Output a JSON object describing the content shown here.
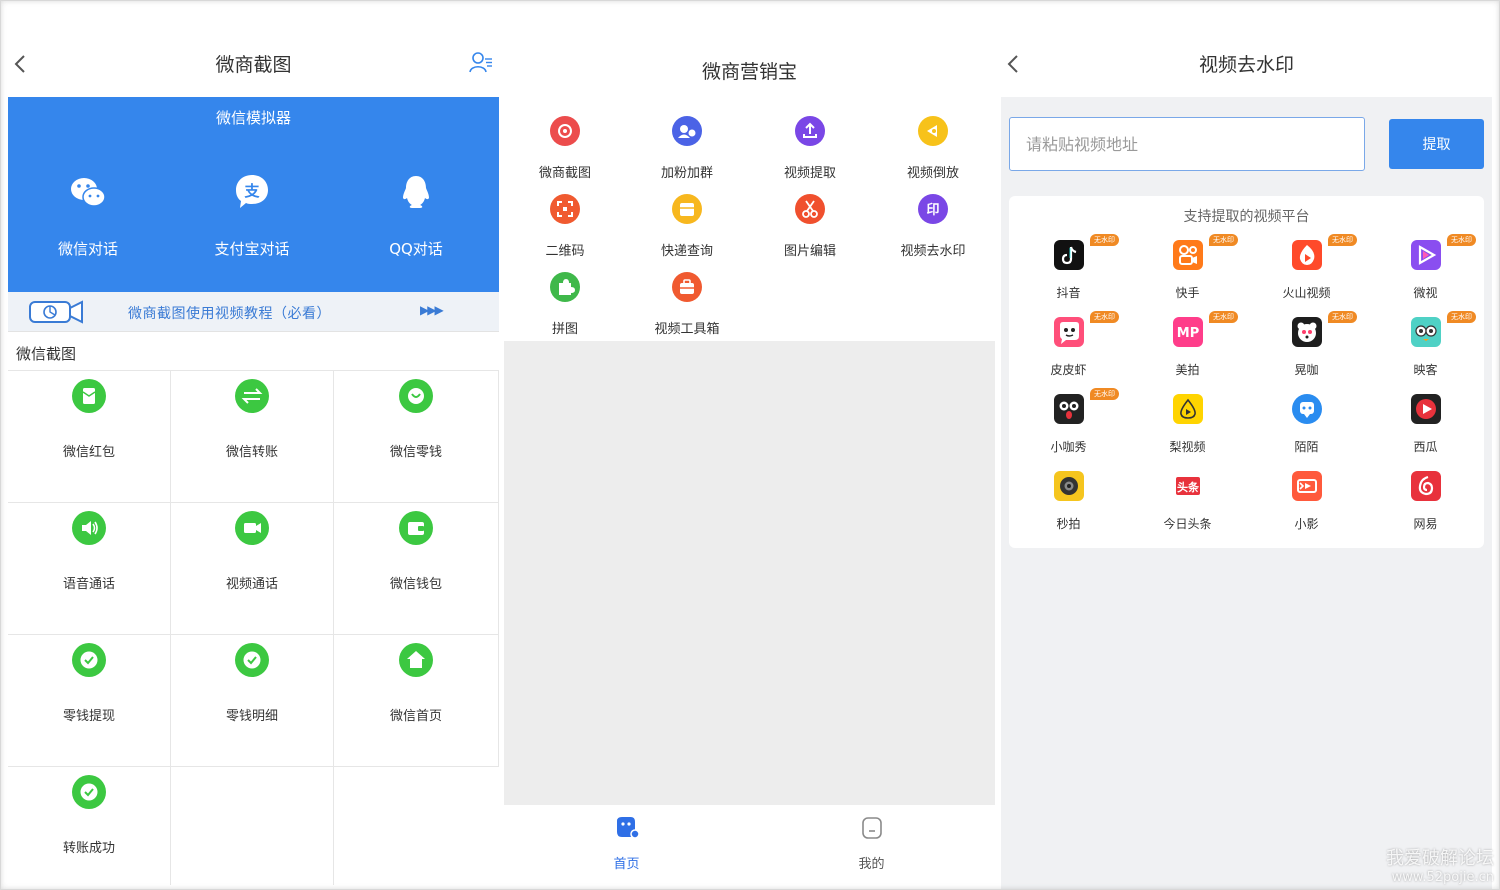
{
  "panel1": {
    "title": "微商截图",
    "simulator": {
      "title": "微信模拟器",
      "items": [
        {
          "label": "微信对话",
          "icon": "wechat-icon"
        },
        {
          "label": "支付宝对话",
          "icon": "alipay-icon"
        },
        {
          "label": "QQ对话",
          "icon": "qq-icon"
        }
      ]
    },
    "tutorial": {
      "text": "微商截图使用视频教程（必看）",
      "arrows": "▶▶▶"
    },
    "section_title": "微信截图",
    "grid": [
      {
        "label": "微信红包",
        "icon": "red-packet-icon"
      },
      {
        "label": "微信转账",
        "icon": "transfer-icon"
      },
      {
        "label": "微信零钱",
        "icon": "change-icon"
      },
      {
        "label": "语音通话",
        "icon": "voice-call-icon"
      },
      {
        "label": "视频通话",
        "icon": "video-call-icon"
      },
      {
        "label": "微信钱包",
        "icon": "wallet-icon"
      },
      {
        "label": "零钱提现",
        "icon": "withdraw-icon"
      },
      {
        "label": "零钱明细",
        "icon": "details-icon"
      },
      {
        "label": "微信首页",
        "icon": "home-icon"
      },
      {
        "label": "转账成功",
        "icon": "success-icon"
      }
    ],
    "colors": {
      "blue": "#3586ec",
      "green": "#3cc841"
    }
  },
  "panel2": {
    "title": "微商营销宝",
    "tools": [
      {
        "label": "微商截图",
        "color": "#ec4c4c"
      },
      {
        "label": "加粉加群",
        "color": "#4b63e6"
      },
      {
        "label": "视频提取",
        "color": "#7a47e6"
      },
      {
        "label": "视频倒放",
        "color": "#f7c21a"
      },
      {
        "label": "二维码",
        "color": "#f05a30"
      },
      {
        "label": "快递查询",
        "color": "#f7b71e"
      },
      {
        "label": "图片编辑",
        "color": "#f0502e"
      },
      {
        "label": "视频去水印",
        "color": "#7a47e6"
      },
      {
        "label": "拼图",
        "color": "#3fb84a"
      },
      {
        "label": "视频工具箱",
        "color": "#f05a30"
      }
    ],
    "tabs": [
      {
        "label": "首页",
        "active": true
      },
      {
        "label": "我的",
        "active": false
      }
    ]
  },
  "panel3": {
    "title": "视频去水印",
    "input_placeholder": "请粘贴视频地址",
    "extract_label": "提取",
    "platform_title": "支持提取的视频平台",
    "badge_text": "无水印",
    "platforms": [
      {
        "label": "抖音",
        "badge": true,
        "bg": "#111111"
      },
      {
        "label": "快手",
        "badge": true,
        "bg": "#ff7a1a"
      },
      {
        "label": "火山视频",
        "badge": true,
        "bg": "#ff4a2a"
      },
      {
        "label": "微视",
        "badge": true,
        "bg": "#8a4ef0"
      },
      {
        "label": "皮皮虾",
        "badge": true,
        "bg": "#ff4f7a"
      },
      {
        "label": "美拍",
        "badge": true,
        "bg": "#ff3d8a"
      },
      {
        "label": "晃咖",
        "badge": true,
        "bg": "#1e1e1e"
      },
      {
        "label": "映客",
        "badge": true,
        "bg": "#4fd1c5"
      },
      {
        "label": "小咖秀",
        "badge": true,
        "bg": "#222222"
      },
      {
        "label": "梨视频",
        "badge": false,
        "bg": "#ffd400"
      },
      {
        "label": "陌陌",
        "badge": false,
        "bg": "#2a8cf0"
      },
      {
        "label": "西瓜",
        "badge": false,
        "bg": "#e8323c"
      },
      {
        "label": "秒拍",
        "badge": false,
        "bg": "#f5c51e"
      },
      {
        "label": "今日头条",
        "badge": false,
        "bg": "#ffffff"
      },
      {
        "label": "小影",
        "badge": false,
        "bg": "#ff5a3c"
      },
      {
        "label": "网易",
        "badge": false,
        "bg": "#e8323c"
      }
    ]
  },
  "watermark": {
    "line1": "我爱破解论坛",
    "line2": "www.52pojie.cn"
  }
}
